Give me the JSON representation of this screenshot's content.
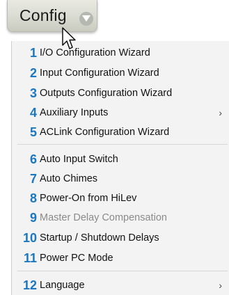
{
  "menu_button": {
    "label": "Config",
    "chevron_icon": "chevron-down-icon"
  },
  "cursor_icon": "mouse-pointer-icon",
  "menu": {
    "number_color": "#1b76c2",
    "items": [
      {
        "number": "1",
        "label": "I/O Configuration Wizard",
        "submenu": false,
        "disabled": false
      },
      {
        "number": "2",
        "label": "Input Configuration Wizard",
        "submenu": false,
        "disabled": false
      },
      {
        "number": "3",
        "label": "Outputs Configuration Wizard",
        "submenu": false,
        "disabled": false
      },
      {
        "number": "4",
        "label": "Auxiliary Inputs",
        "submenu": true,
        "submenu_glyph": "›",
        "disabled": false
      },
      {
        "number": "5",
        "label": "ACLink Configuration Wizard",
        "submenu": false,
        "disabled": false
      },
      {
        "number": "6",
        "label": "Auto Input Switch",
        "submenu": false,
        "disabled": false
      },
      {
        "number": "7",
        "label": "Auto Chimes",
        "submenu": false,
        "disabled": false
      },
      {
        "number": "8",
        "label": "Power-On from HiLev",
        "submenu": false,
        "disabled": false
      },
      {
        "number": "9",
        "label": "Master Delay Compensation",
        "submenu": false,
        "disabled": true
      },
      {
        "number": "10",
        "label": "Startup / Shutdown Delays",
        "submenu": false,
        "disabled": false
      },
      {
        "number": "11",
        "label": "Power PC Mode",
        "submenu": false,
        "disabled": false
      },
      {
        "number": "12",
        "label": "Language",
        "submenu": true,
        "submenu_glyph": "›",
        "disabled": false
      }
    ]
  }
}
